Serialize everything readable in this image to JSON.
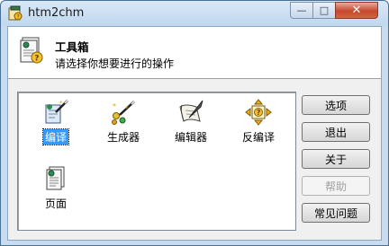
{
  "window": {
    "title": "htm2chm",
    "caption_minimize": "—",
    "caption_maximize": "□",
    "caption_close": "✕"
  },
  "header": {
    "title": "工具箱",
    "subtitle": "请选择你想要进行的操作",
    "icon": "toolbox-document-icon"
  },
  "tools": [
    {
      "label": "编译",
      "icon": "compile-wand-icon",
      "selected": true
    },
    {
      "label": "生成器",
      "icon": "generator-wand-icon",
      "selected": false
    },
    {
      "label": "编辑器",
      "icon": "editor-quill-icon",
      "selected": false
    },
    {
      "label": "反编译",
      "icon": "decompile-arrows-icon",
      "selected": false
    },
    {
      "label": "页面",
      "icon": "page-document-icon",
      "selected": false
    }
  ],
  "buttons": [
    {
      "label": "选项",
      "enabled": true
    },
    {
      "label": "退出",
      "enabled": true
    },
    {
      "label": "关于",
      "enabled": true
    },
    {
      "label": "帮助",
      "enabled": false
    },
    {
      "label": "常见问题",
      "enabled": true
    }
  ],
  "colors": {
    "selection": "#3399ff",
    "close_button": "#c7472e",
    "frame": "#c9dcef"
  }
}
